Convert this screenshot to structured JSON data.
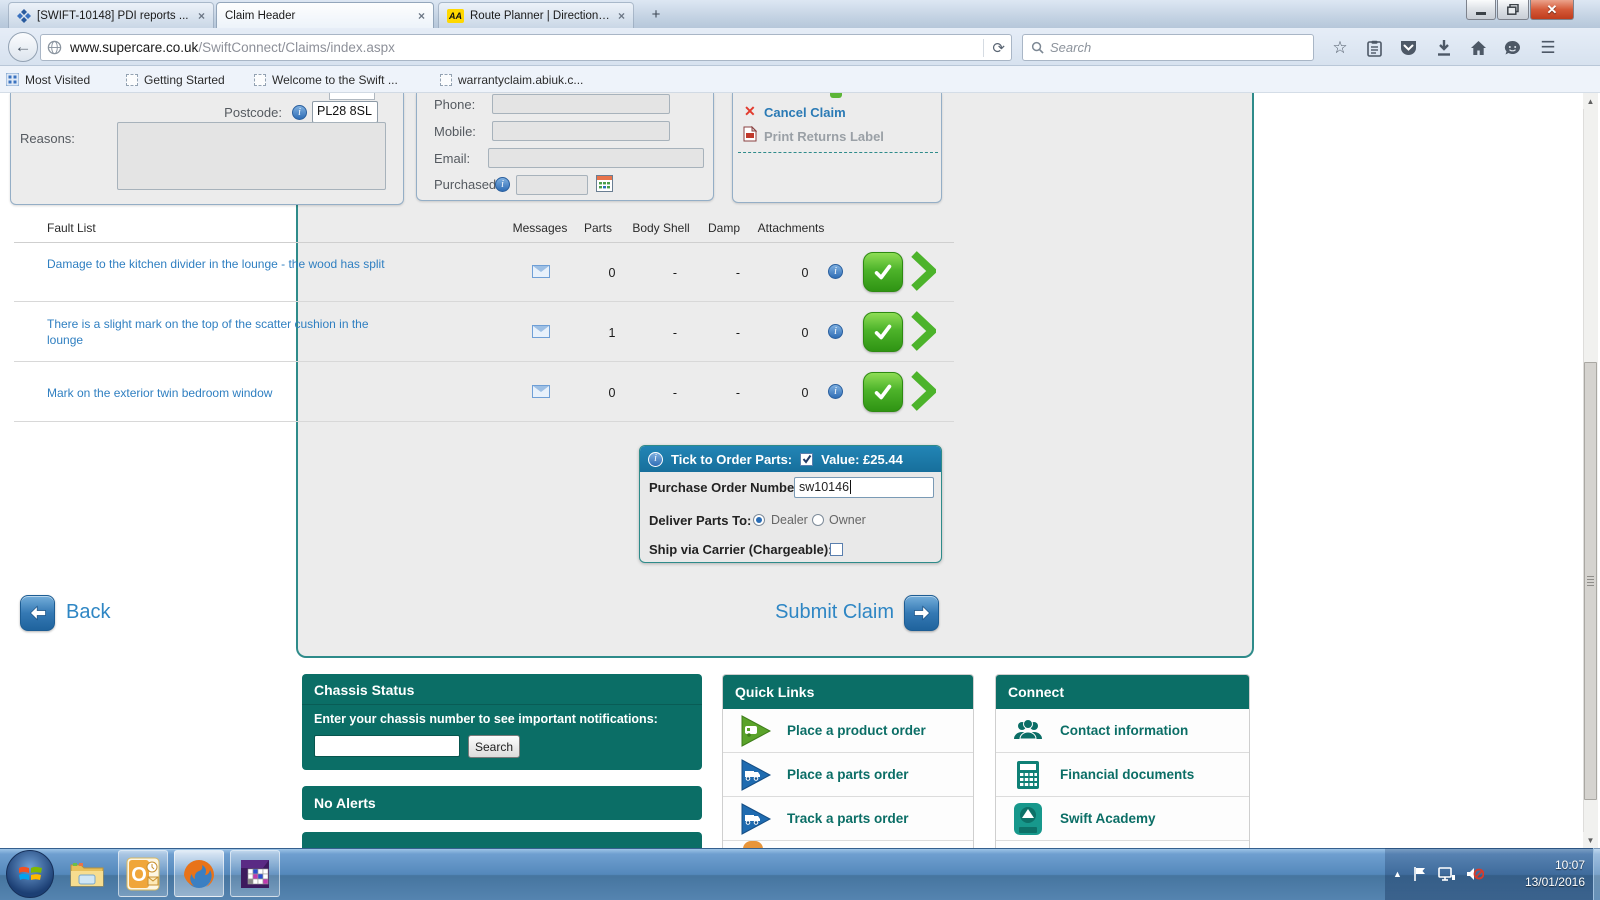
{
  "browser": {
    "tabs": [
      {
        "title": "[SWIFT-10148] PDI reports ...",
        "close": "×"
      },
      {
        "title": "Claim Header",
        "close": "×"
      },
      {
        "title": "Route Planner | Directions, ...",
        "close": "×"
      }
    ],
    "new_tab_label": "+",
    "aa_icon_text": "AA",
    "url": {
      "domain": "www.supercare.co.uk",
      "path": "/SwiftConnect/Claims/index.aspx"
    },
    "search_placeholder": "Search",
    "bookmarks": [
      "Most Visited",
      "Getting Started",
      "Welcome to the Swift ...",
      "warrantyclaim.abiuk.c..."
    ]
  },
  "claim_form": {
    "postcode_label": "Postcode:",
    "postcode_value": "PL28 8SL",
    "reasons_label": "Reasons:",
    "phone_label": "Phone:",
    "mobile_label": "Mobile:",
    "email_label": "Email:",
    "purchased_label": "Purchased:",
    "cancel_claim_label": "Cancel Claim",
    "print_returns_label": "Print Returns Label"
  },
  "fault_list": {
    "title": "Fault List",
    "columns": {
      "messages": "Messages",
      "parts": "Parts",
      "body_shell": "Body Shell",
      "damp": "Damp",
      "attachments": "Attachments"
    },
    "rows": [
      {
        "description": "Damage to the kitchen divider in the lounge - the wood has split",
        "parts": "0",
        "body_shell": "-",
        "damp": "-",
        "attachments": "0"
      },
      {
        "description": "There is a slight mark on the top of the scatter cushion in the lounge",
        "parts": "1",
        "body_shell": "-",
        "damp": "-",
        "attachments": "0"
      },
      {
        "description": "Mark on the exterior twin bedroom window",
        "parts": "0",
        "body_shell": "-",
        "damp": "-",
        "attachments": "0"
      }
    ]
  },
  "order_parts": {
    "header_label": "Tick to Order Parts:",
    "value_label": "Value: £25.44",
    "po_label": "Purchase Order Number:",
    "po_value": "sw10146",
    "deliver_label": "Deliver Parts To:",
    "option_dealer": "Dealer",
    "option_owner": "Owner",
    "ship_label": "Ship via Carrier (Chargeable):"
  },
  "nav_buttons": {
    "back_label": "Back",
    "submit_label": "Submit Claim"
  },
  "footer": {
    "chassis": {
      "title": "Chassis Status",
      "prompt": "Enter your chassis number to see important notifications:",
      "search_label": "Search"
    },
    "alerts_title": "No Alerts",
    "quick_links": {
      "title": "Quick Links",
      "items": [
        "Place a product order",
        "Place a parts order",
        "Track a parts order"
      ]
    },
    "connect": {
      "title": "Connect",
      "items": [
        "Contact information",
        "Financial documents",
        "Swift Academy"
      ]
    }
  },
  "taskbar": {
    "time": "10:07",
    "date": "13/01/2016"
  },
  "colors": {
    "teal": "#0b6e66",
    "steel_blue": "#1b7aa9",
    "link_blue": "#2f7fc1",
    "green_button": "#3fa51d",
    "accent_blue": "#2e86c4"
  }
}
